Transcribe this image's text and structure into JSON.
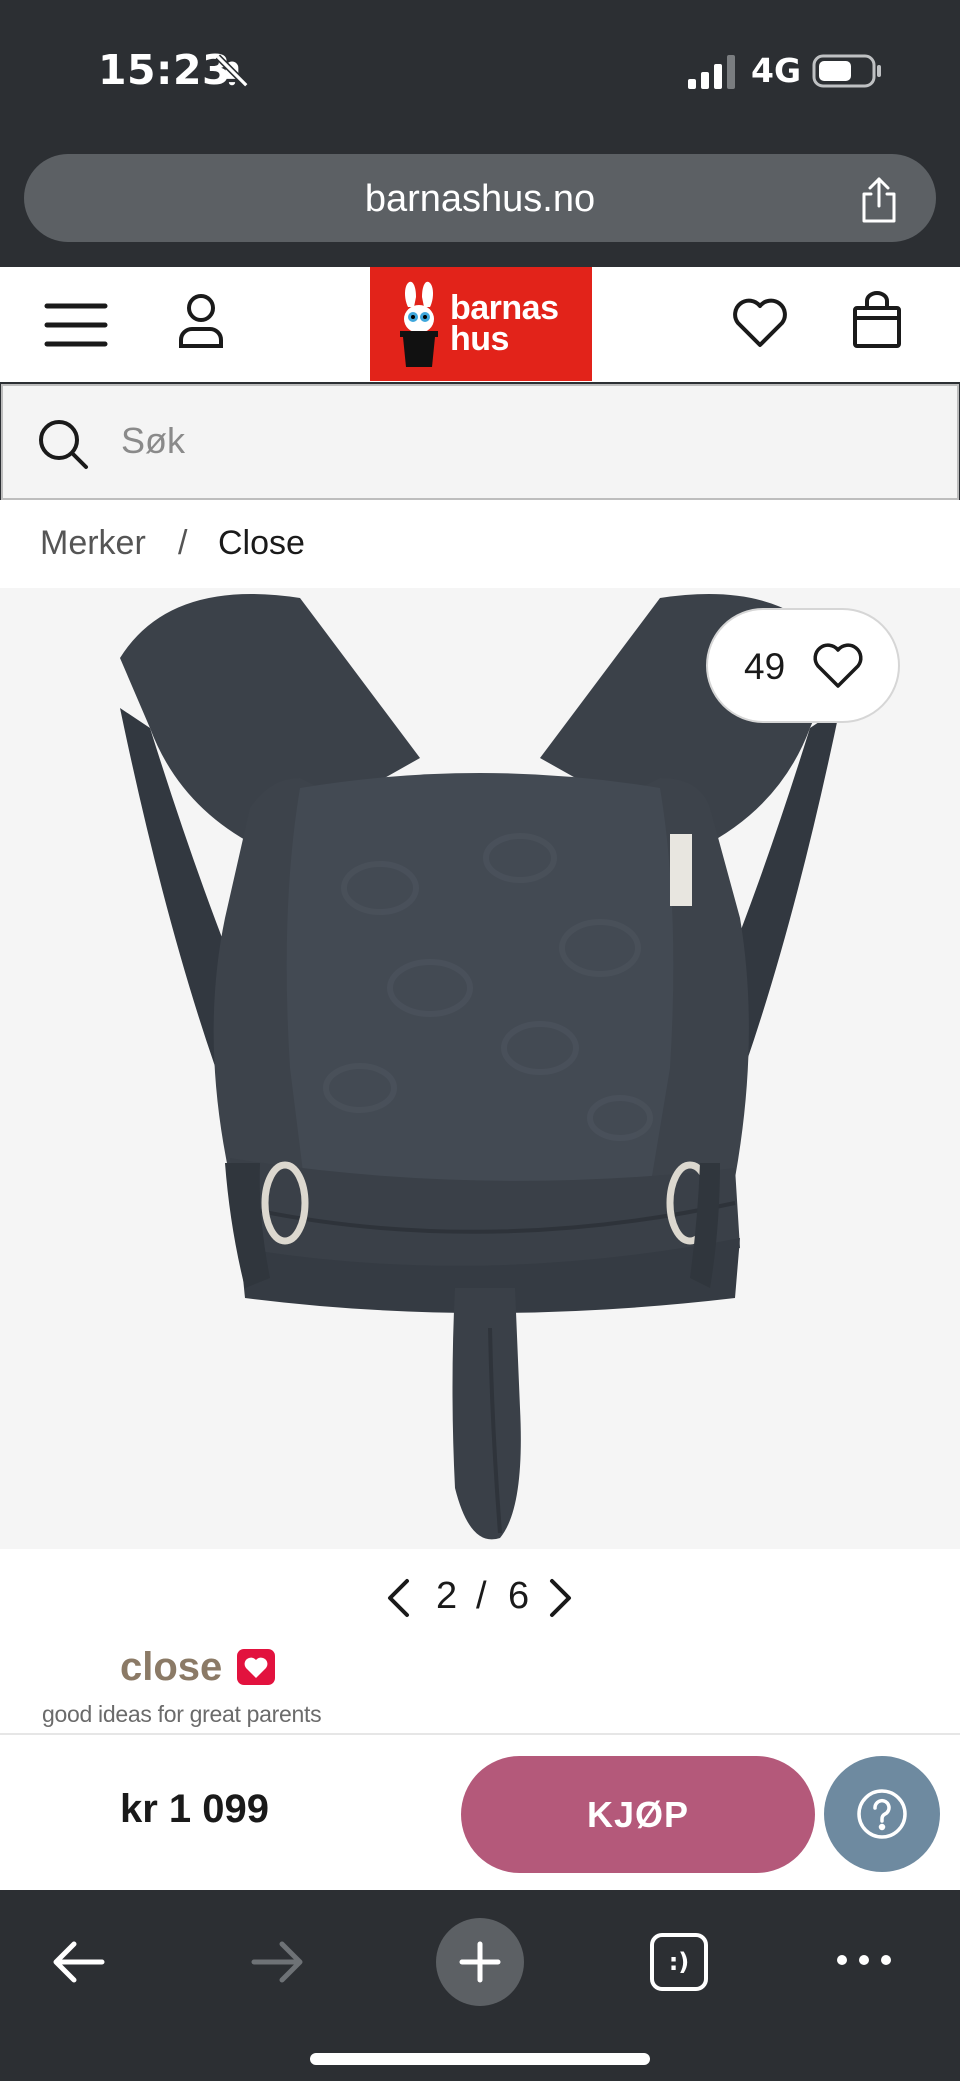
{
  "status_bar": {
    "time": "15:23",
    "network": "4G",
    "icons": [
      "bell-off-icon",
      "signal-icon",
      "battery-icon"
    ]
  },
  "browser": {
    "url": "barnashus.no",
    "icons": [
      "share-icon",
      "back-arrow-icon",
      "forward-arrow-icon",
      "plus-icon",
      "tabs-icon",
      "more-icon"
    ],
    "tabs_label": ":)"
  },
  "header": {
    "logo_line1": "barnas",
    "logo_line2": "hus",
    "icons": [
      "menu-icon",
      "user-icon",
      "heart-icon",
      "bag-icon"
    ],
    "brand_color": "#e2231a"
  },
  "search": {
    "placeholder": "Søk"
  },
  "breadcrumb": {
    "items": [
      "Merker",
      "Close"
    ],
    "separator": "/"
  },
  "product": {
    "favorites_count": "49",
    "image_pager": {
      "current": "2",
      "separator": "/",
      "total": "6"
    },
    "brand_name": "close",
    "brand_tagline": "good ideas for great parents",
    "price": "kr 1 099",
    "buy_label": "KJØP"
  },
  "colors": {
    "buy_button": "#b4597a",
    "help_button": "#6e8aa0",
    "brand_heart": "#e2123e",
    "browser_chrome": "#2c2f33"
  }
}
